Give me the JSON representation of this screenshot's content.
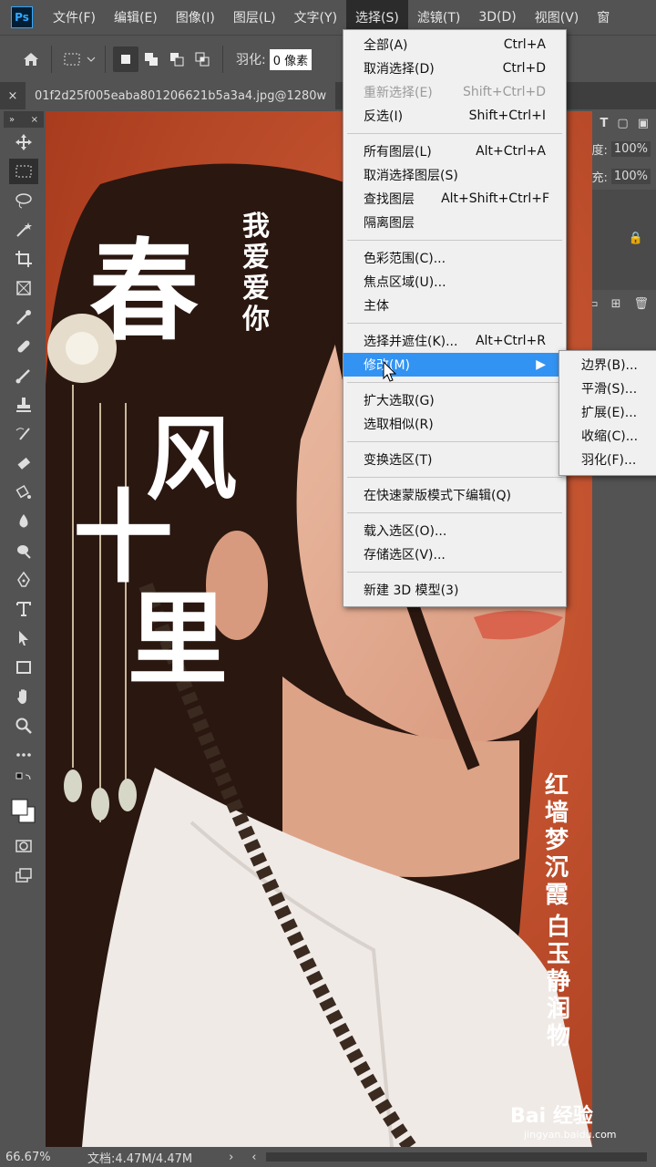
{
  "app": {
    "logo": "Ps"
  },
  "menubar": [
    "文件(F)",
    "编辑(E)",
    "图像(I)",
    "图层(L)",
    "文字(Y)",
    "选择(S)",
    "滤镜(T)",
    "3D(D)",
    "视图(V)",
    "窗"
  ],
  "options": {
    "feather_label": "羽化:",
    "feather_value": "0 像素"
  },
  "tab": {
    "filename": "01f2d25f005eaba801206621b5a3a4.jpg@1280w"
  },
  "right_panel": {
    "opacity_label": "透明度:",
    "opacity_value": "100%",
    "fill_label": "填充:",
    "fill_value": "100%"
  },
  "select_menu": {
    "all": {
      "label": "全部(A)",
      "shortcut": "Ctrl+A"
    },
    "deselect": {
      "label": "取消选择(D)",
      "shortcut": "Ctrl+D"
    },
    "reselect": {
      "label": "重新选择(E)",
      "shortcut": "Shift+Ctrl+D"
    },
    "inverse": {
      "label": "反选(I)",
      "shortcut": "Shift+Ctrl+I"
    },
    "all_layers": {
      "label": "所有图层(L)",
      "shortcut": "Alt+Ctrl+A"
    },
    "deselect_layers": {
      "label": "取消选择图层(S)",
      "shortcut": ""
    },
    "find_layers": {
      "label": "查找图层",
      "shortcut": "Alt+Shift+Ctrl+F"
    },
    "isolate_layers": {
      "label": "隔离图层",
      "shortcut": ""
    },
    "color_range": {
      "label": "色彩范围(C)...",
      "shortcut": ""
    },
    "focus_area": {
      "label": "焦点区域(U)...",
      "shortcut": ""
    },
    "subject": {
      "label": "主体",
      "shortcut": ""
    },
    "select_mask": {
      "label": "选择并遮住(K)...",
      "shortcut": "Alt+Ctrl+R"
    },
    "modify": {
      "label": "修改(M)",
      "shortcut": ""
    },
    "grow": {
      "label": "扩大选取(G)",
      "shortcut": ""
    },
    "similar": {
      "label": "选取相似(R)",
      "shortcut": ""
    },
    "transform": {
      "label": "变换选区(T)",
      "shortcut": ""
    },
    "quickmask": {
      "label": "在快速蒙版模式下编辑(Q)",
      "shortcut": ""
    },
    "load": {
      "label": "载入选区(O)...",
      "shortcut": ""
    },
    "save": {
      "label": "存储选区(V)...",
      "shortcut": ""
    },
    "new3d": {
      "label": "新建 3D 模型(3)",
      "shortcut": ""
    }
  },
  "modify_submenu": [
    "边界(B)...",
    "平滑(S)...",
    "扩展(E)...",
    "收缩(C)...",
    "羽化(F)..."
  ],
  "canvas_text": {
    "t1": "春",
    "t2": "风",
    "t3": "十",
    "t4": "里",
    "poem": "我爱爱你",
    "right_line1": "红墙梦沉霞",
    "right_line2": "白玉静润物"
  },
  "status": {
    "zoom": "66.67%",
    "doc": "文档:4.47M/4.47M"
  },
  "watermark": {
    "main": "Bai 经验",
    "sub": "jingyan.baidu.com"
  }
}
